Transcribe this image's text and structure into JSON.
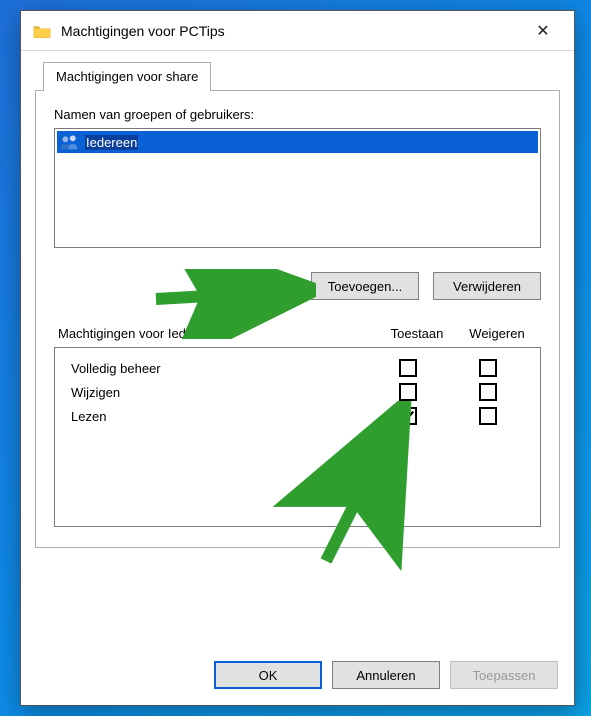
{
  "window": {
    "title": "Machtigingen voor PCTips",
    "close": "✕"
  },
  "tab": "Machtigingen voor share",
  "groups": {
    "label": "Namen van groepen of gebruikers:",
    "selected": "Iedereen"
  },
  "buttons": {
    "add": "Toevoegen...",
    "remove": "Verwijderen",
    "ok": "OK",
    "cancel": "Annuleren",
    "apply": "Toepassen"
  },
  "perms": {
    "header": "Machtigingen voor Iedereen",
    "allow": "Toestaan",
    "deny": "Weigeren",
    "rows": [
      {
        "label": "Volledig beheer",
        "allow": false,
        "deny": false
      },
      {
        "label": "Wijzigen",
        "allow": false,
        "deny": false
      },
      {
        "label": "Lezen",
        "allow": true,
        "deny": false
      }
    ]
  },
  "colors": {
    "selection": "#0a61d6",
    "arrow": "#2f9e2f"
  }
}
